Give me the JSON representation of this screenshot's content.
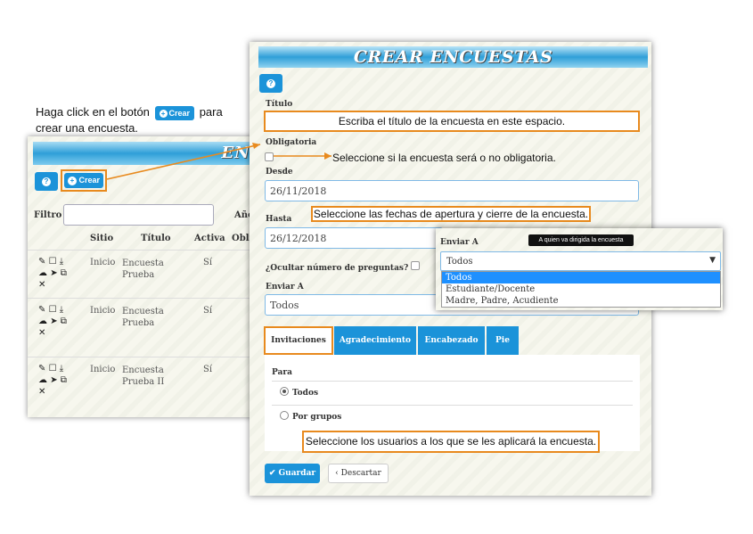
{
  "instruction": {
    "before": "Haga click en el botón",
    "button": "Crear",
    "after": "para crear una encuesta."
  },
  "list_window": {
    "banner": "ENC",
    "crear_label": "Crear",
    "filter_label": "Filtro",
    "filter_value": "",
    "year_label": "Año",
    "columns": [
      "Sitio",
      "Título",
      "Activa",
      "Oblig"
    ],
    "rows": [
      {
        "sitio": "Inicio",
        "titulo": "Encuesta Prueba",
        "activa": "Sí"
      },
      {
        "sitio": "Inicio",
        "titulo": "Encuesta Prueba",
        "activa": "Sí"
      },
      {
        "sitio": "Inicio",
        "titulo": "Encuesta Prueba II",
        "activa": "Sí"
      }
    ],
    "row_icons": [
      "pencil-icon",
      "edit-icon",
      "download-icon",
      "cloud-upload-icon",
      "send-icon",
      "copy-icon",
      "delete-icon"
    ]
  },
  "main": {
    "banner": "CREAR ENCUESTAS",
    "title_label": "Título",
    "title_callout": "Escriba el título de la encuesta en este espacio.",
    "oblig_label": "Obligatoria",
    "oblig_callout": "Seleccione si la encuesta será o no obligatoria.",
    "desde_label": "Desde",
    "desde_value": "26/11/2018",
    "hasta_label": "Hasta",
    "hasta_value": "26/12/2018",
    "dates_callout": "Seleccione las fechas de apertura y cierre de la encuesta.",
    "ocultar_label": "¿Ocultar número de preguntas?",
    "enviar_label": "Enviar A",
    "enviar_value": "Todos",
    "tabs": [
      "Invitaciones",
      "Agradecimiento",
      "Encabezado",
      "Pie"
    ],
    "para_label": "Para",
    "radio_todos": "Todos",
    "radio_grupos": "Por grupos",
    "users_callout": "Seleccione los usuarios a los que se les aplicará la encuesta.",
    "guardar": "Guardar",
    "descartar": "Descartar"
  },
  "popup": {
    "label": "Enviar A",
    "tooltip": "A quien va dirigida la encuesta",
    "selected": "Todos",
    "options": [
      "Todos",
      "Estudiante/Docente",
      "Madre, Padre, Acudiente"
    ]
  },
  "colors": {
    "accent": "#1b93d9",
    "callout_border": "#e88a1e"
  }
}
